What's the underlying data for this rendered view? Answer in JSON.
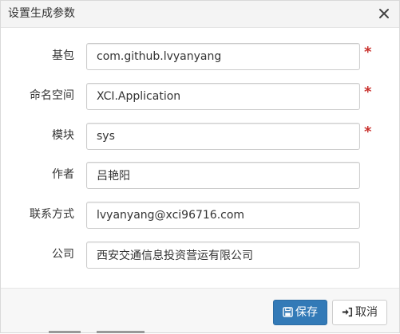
{
  "dialog": {
    "title": "设置生成参数",
    "close_icon": "close-icon"
  },
  "form": {
    "fields": [
      {
        "label": "基包",
        "value": "com.github.lvyanyang",
        "required": true
      },
      {
        "label": "命名空间",
        "value": "XCI.Application",
        "required": true
      },
      {
        "label": "模块",
        "value": "sys",
        "required": true
      },
      {
        "label": "作者",
        "value": "吕艳阳",
        "required": false
      },
      {
        "label": "联系方式",
        "value": "lvyanyang@xci96716.com",
        "required": false
      },
      {
        "label": "公司",
        "value": "西安交通信息投资营运有限公司",
        "required": false
      }
    ],
    "required_mark": "*"
  },
  "footer": {
    "save_label": "保存",
    "save_icon": "floppy-disk-icon",
    "cancel_label": "取消",
    "cancel_icon": "sign-in-icon"
  },
  "colors": {
    "primary": "#337ab7",
    "required": "#c9302c",
    "header_bg": "#f4f4f4"
  }
}
